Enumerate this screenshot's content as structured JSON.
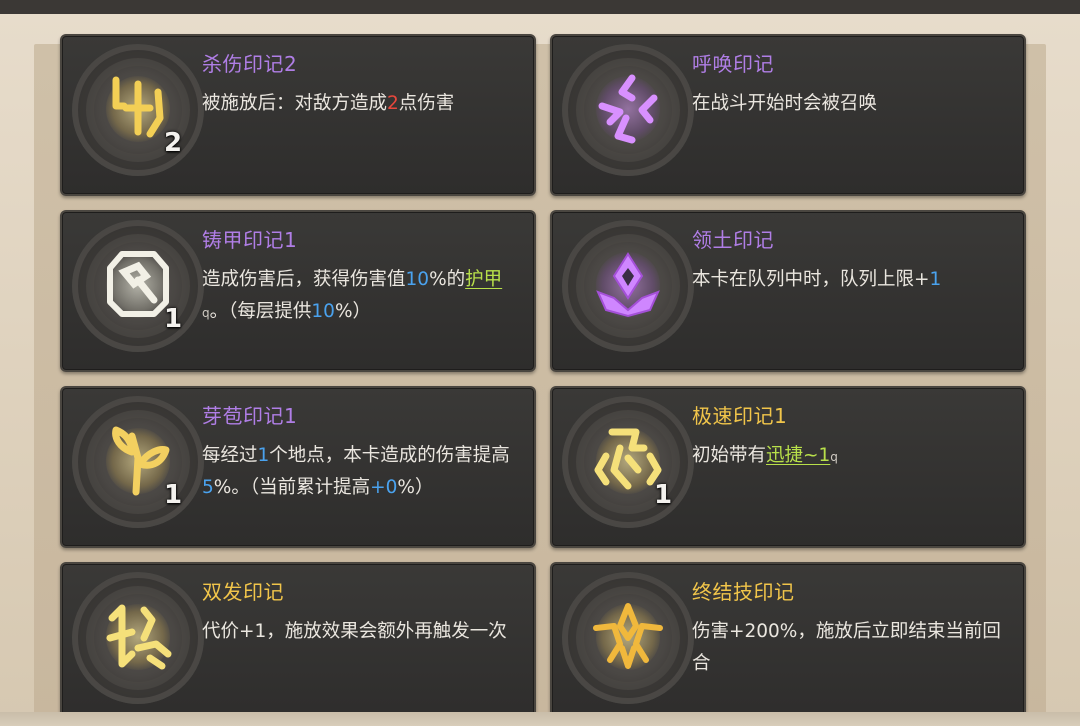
{
  "cards": [
    {
      "icon": "rune-blade-icon",
      "title": "杀伤印记2",
      "title_color": "#b07ee6",
      "stack": "2",
      "desc": [
        {
          "t": "被施放后：对敌方造成"
        },
        {
          "t": "2",
          "c": "red"
        },
        {
          "t": "点伤害"
        }
      ]
    },
    {
      "icon": "rune-summon-icon",
      "title": "呼唤印记",
      "title_color": "#b07ee6",
      "stack": "",
      "desc": [
        {
          "t": "在战斗开始时会被召唤"
        }
      ]
    },
    {
      "icon": "rune-armor-hammer-icon",
      "title": "铸甲印记1",
      "title_color": "#b07ee6",
      "stack": "1",
      "desc": [
        {
          "t": "造成伤害后，获得伤害值"
        },
        {
          "t": "10",
          "c": "blue"
        },
        {
          "t": "%的"
        },
        {
          "t": "护甲",
          "c": "kw"
        },
        {
          "t": "q",
          "c": "q"
        },
        {
          "t": "。（每层提供"
        },
        {
          "t": "10",
          "c": "blue"
        },
        {
          "t": "%）"
        }
      ]
    },
    {
      "icon": "rune-territory-icon",
      "title": "领土印记",
      "title_color": "#b07ee6",
      "stack": "",
      "desc": [
        {
          "t": "本卡在队列中时，队列上限+"
        },
        {
          "t": "1",
          "c": "blue"
        }
      ]
    },
    {
      "icon": "rune-sprout-icon",
      "title": "芽苞印记1",
      "title_color": "#b07ee6",
      "stack": "1",
      "desc": [
        {
          "t": "每经过"
        },
        {
          "t": "1",
          "c": "blue"
        },
        {
          "t": "个地点，本卡造成的伤害提高"
        },
        {
          "t": "5",
          "c": "blue"
        },
        {
          "t": "%。（当前累计提高"
        },
        {
          "t": "+0",
          "c": "blue"
        },
        {
          "t": "%）"
        }
      ]
    },
    {
      "icon": "rune-haste-icon",
      "title": "极速印记1",
      "title_color": "#f1c54a",
      "stack": "1",
      "desc": [
        {
          "t": "初始带有"
        },
        {
          "t": "迅捷~1",
          "c": "kw"
        },
        {
          "t": "q",
          "c": "q"
        }
      ]
    },
    {
      "icon": "rune-double-icon",
      "title": "双发印记",
      "title_color": "#f1c54a",
      "stack": "",
      "desc": [
        {
          "t": "代价+1，施放效果会额外再触发一次"
        }
      ]
    },
    {
      "icon": "rune-finisher-icon",
      "title": "终结技印记",
      "title_color": "#f1c54a",
      "stack": "",
      "desc": [
        {
          "t": "伤害+200%，施放后立即结束当前回合"
        }
      ]
    }
  ],
  "colors": {
    "purple": "#b07ee6",
    "gold": "#f1c54a",
    "value_blue": "#4aa2ee",
    "value_red": "#e9473c",
    "keyword_green": "#b8e04a"
  }
}
